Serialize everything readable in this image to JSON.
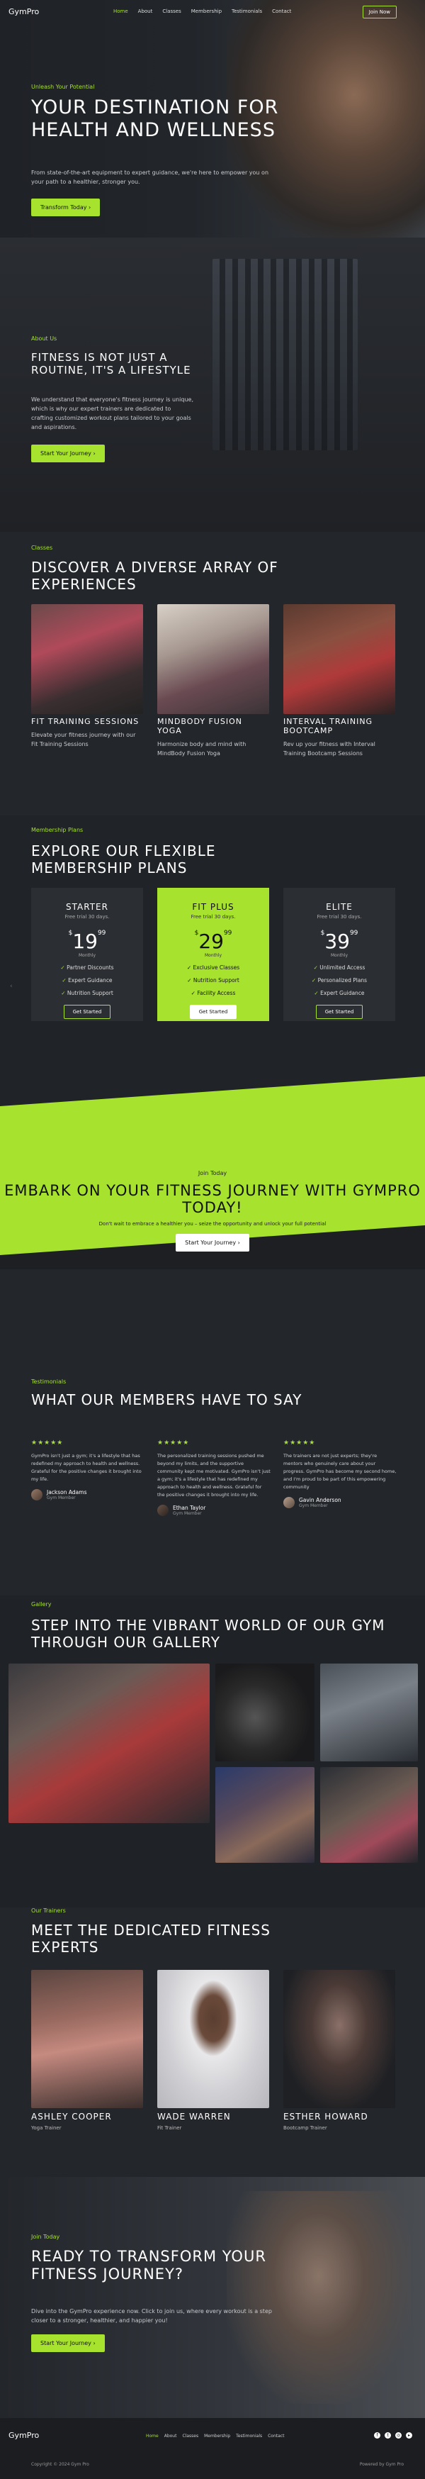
{
  "nav": {
    "logo": "GymPro",
    "links": [
      "Home",
      "About",
      "Classes",
      "Membership",
      "Testimonials",
      "Contact"
    ],
    "cta": "Join Now"
  },
  "hero": {
    "eyebrow": "Unleash Your Potential",
    "title": "YOUR DESTINATION FOR HEALTH AND WELLNESS",
    "text": "From state-of-the-art equipment to expert guidance, we're here to empower you on your path to a healthier, stronger you.",
    "cta": "Transform Today"
  },
  "about": {
    "eyebrow": "About Us",
    "title": "FITNESS IS NOT JUST A ROUTINE, IT'S A LIFESTYLE",
    "text": "We understand that everyone's fitness journey is unique, which is why our expert trainers are dedicated to crafting customized workout plans tailored to your goals and aspirations.",
    "cta": "Start Your Journey"
  },
  "classes": {
    "eyebrow": "Classes",
    "title": "DISCOVER A DIVERSE ARRAY OF EXPERIENCES",
    "items": [
      {
        "title": "FIT TRAINING SESSIONS",
        "text": "Elevate your fitness journey with our Fit Training Sessions"
      },
      {
        "title": "MINDBODY FUSION YOGA",
        "text": "Harmonize body and mind with MindBody Fusion Yoga"
      },
      {
        "title": "INTERVAL TRAINING BOOTCAMP",
        "text": "Rev up your fitness with Interval Training Bootcamp Sessions"
      }
    ]
  },
  "membership": {
    "eyebrow": "Membership Plans",
    "title": "EXPLORE OUR FLEXIBLE MEMBERSHIP PLANS",
    "plans": [
      {
        "name": "STARTER",
        "trial": "Free trial 30 days.",
        "dollar": "$",
        "price": "19",
        "cents": "99",
        "per": "Monthly",
        "features": [
          "Partner Discounts",
          "Expert Guidance",
          "Nutrition Support"
        ],
        "cta": "Get Started"
      },
      {
        "name": "FIT PLUS",
        "trial": "Free trial 30 days.",
        "dollar": "$",
        "price": "29",
        "cents": "99",
        "per": "Monthly",
        "features": [
          "Exclusive Classes",
          "Nutrition Support",
          "Facility Access"
        ],
        "cta": "Get Started"
      },
      {
        "name": "ELITE",
        "trial": "Free trial 30 days.",
        "dollar": "$",
        "price": "39",
        "cents": "99",
        "per": "Monthly",
        "features": [
          "Unlimited Access",
          "Personalized Plans",
          "Expert Guidance"
        ],
        "cta": "Get Started"
      }
    ]
  },
  "band": {
    "eyebrow": "Join Today",
    "title": "EMBARK ON YOUR FITNESS JOURNEY WITH GYMPRO TODAY!",
    "text": "Don't wait to embrace a healthier you – seize the opportunity and unlock your full potential",
    "cta": "Start Your Journey"
  },
  "testimonials": {
    "eyebrow": "Testimonials",
    "title": "WHAT OUR MEMBERS HAVE TO SAY",
    "stars": "★★★★★",
    "items": [
      {
        "text": "GymPro isn't just a gym; it's a lifestyle that has redefined my approach to health and wellness. Grateful for the positive changes it brought into my life.",
        "name": "Jackson Adams",
        "role": "Gym Member"
      },
      {
        "text": "The personalized training sessions pushed me beyond my limits, and the supportive community kept me motivated. GymPro isn't just a gym; it's a lifestyle that has redefined my approach to health and wellness. Grateful for the positive changes it brought into my life.",
        "name": "Ethan Taylor",
        "role": "Gym Member"
      },
      {
        "text": "The trainers are not just experts; they're mentors who genuinely care about your progress. GymPro has become my second home, and I'm proud to be part of this empowering community",
        "name": "Gavin Anderson",
        "role": "Gym Member"
      }
    ]
  },
  "gallery": {
    "eyebrow": "Gallery",
    "title": "STEP INTO THE VIBRANT WORLD OF OUR GYM THROUGH OUR GALLERY"
  },
  "trainers": {
    "eyebrow": "Our Trainers",
    "title": "MEET THE DEDICATED FITNESS EXPERTS",
    "items": [
      {
        "name": "ASHLEY COOPER",
        "role": "Yoga Trainer"
      },
      {
        "name": "WADE WARREN",
        "role": "Fit Trainer"
      },
      {
        "name": "ESTHER HOWARD",
        "role": "Bootcamp Trainer"
      }
    ]
  },
  "join": {
    "eyebrow": "Join Today",
    "title": "READY TO TRANSFORM YOUR FITNESS JOURNEY?",
    "text": "Dive into the GymPro experience now. Click to join us, where every workout is a step closer to a stronger, healthier, and happier you!",
    "cta": "Start Your Journey"
  },
  "footer": {
    "logo": "GymPro",
    "links": [
      "Home",
      "About",
      "Classes",
      "Membership",
      "Testimonials",
      "Contact"
    ],
    "copyright": "Copyright © 2024 Gym Pro",
    "powered": "Powered by Gym Pro",
    "social_icons": [
      "facebook-icon",
      "twitter-icon",
      "instagram-icon",
      "youtube-icon"
    ]
  },
  "colors": {
    "accent": "#a6e22e",
    "background": "#1d1f23"
  }
}
